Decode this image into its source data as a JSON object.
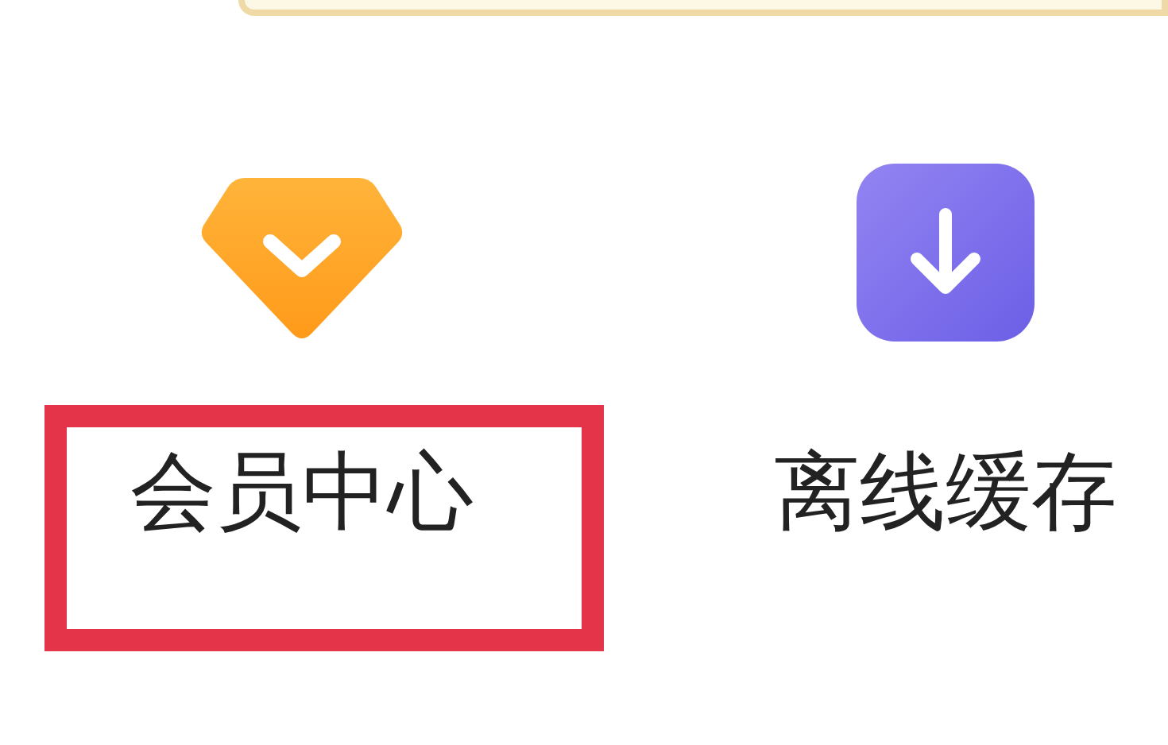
{
  "entries": [
    {
      "kind": "diamond",
      "label": "会员中心",
      "highlighted": true
    },
    {
      "kind": "download",
      "label": "离线缓存",
      "highlighted": false
    }
  ]
}
